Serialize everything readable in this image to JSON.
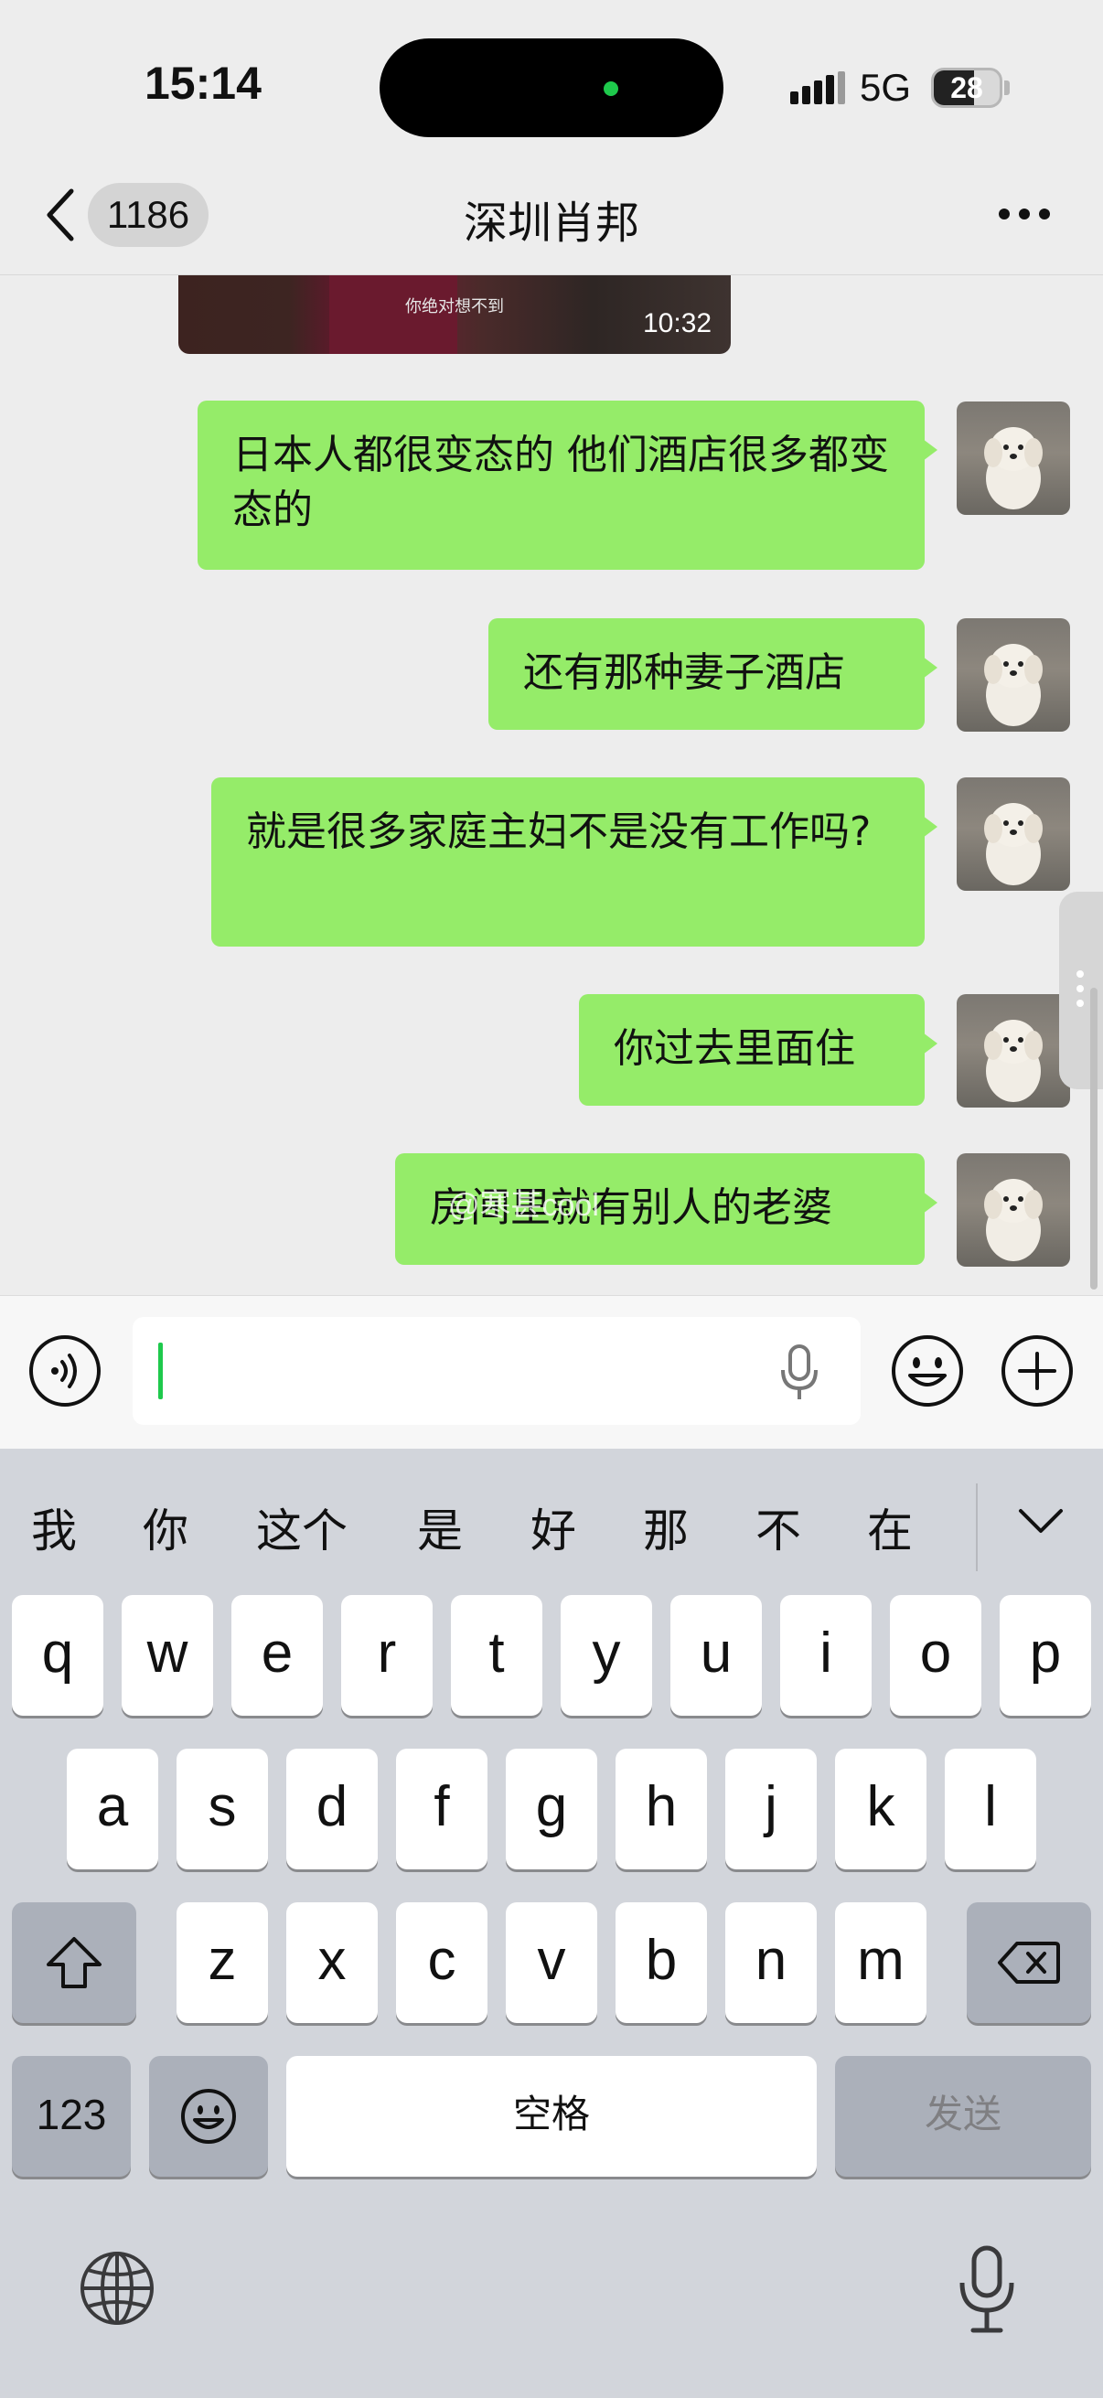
{
  "status_bar": {
    "time": "15:14",
    "network": "5G",
    "battery": "28"
  },
  "nav": {
    "unread_count": "1186",
    "title": "深圳肖邦"
  },
  "chat": {
    "video": {
      "caption": "你绝对想不到",
      "duration": "10:32"
    },
    "messages": [
      {
        "text": "日本人都很变态的 他们酒店很多都变态的"
      },
      {
        "text": "还有那种妻子酒店"
      },
      {
        "text": "就是很多家庭主妇不是没有工作吗?"
      },
      {
        "text": "你过去里面住"
      },
      {
        "text": "房间里就有别人的老婆"
      }
    ],
    "watermark": "@寒甚cool"
  },
  "input": {
    "value": ""
  },
  "keyboard": {
    "candidates": [
      "我",
      "你",
      "这个",
      "是",
      "好",
      "那",
      "不",
      "在"
    ],
    "row1": [
      "q",
      "w",
      "e",
      "r",
      "t",
      "y",
      "u",
      "i",
      "o",
      "p"
    ],
    "row2": [
      "a",
      "s",
      "d",
      "f",
      "g",
      "h",
      "j",
      "k",
      "l"
    ],
    "row3": [
      "z",
      "x",
      "c",
      "v",
      "b",
      "n",
      "m"
    ],
    "numbers_label": "123",
    "space_label": "空格",
    "send_label": "发送"
  },
  "colors": {
    "bubble": "#95ec69",
    "accent": "#1ec94c",
    "background": "#ededed"
  },
  "icons": [
    "back-icon",
    "more-icon",
    "voice-icon",
    "microphone-icon",
    "emoji-icon",
    "plus-icon",
    "shift-icon",
    "backspace-icon",
    "globe-icon",
    "collapse-icon"
  ]
}
